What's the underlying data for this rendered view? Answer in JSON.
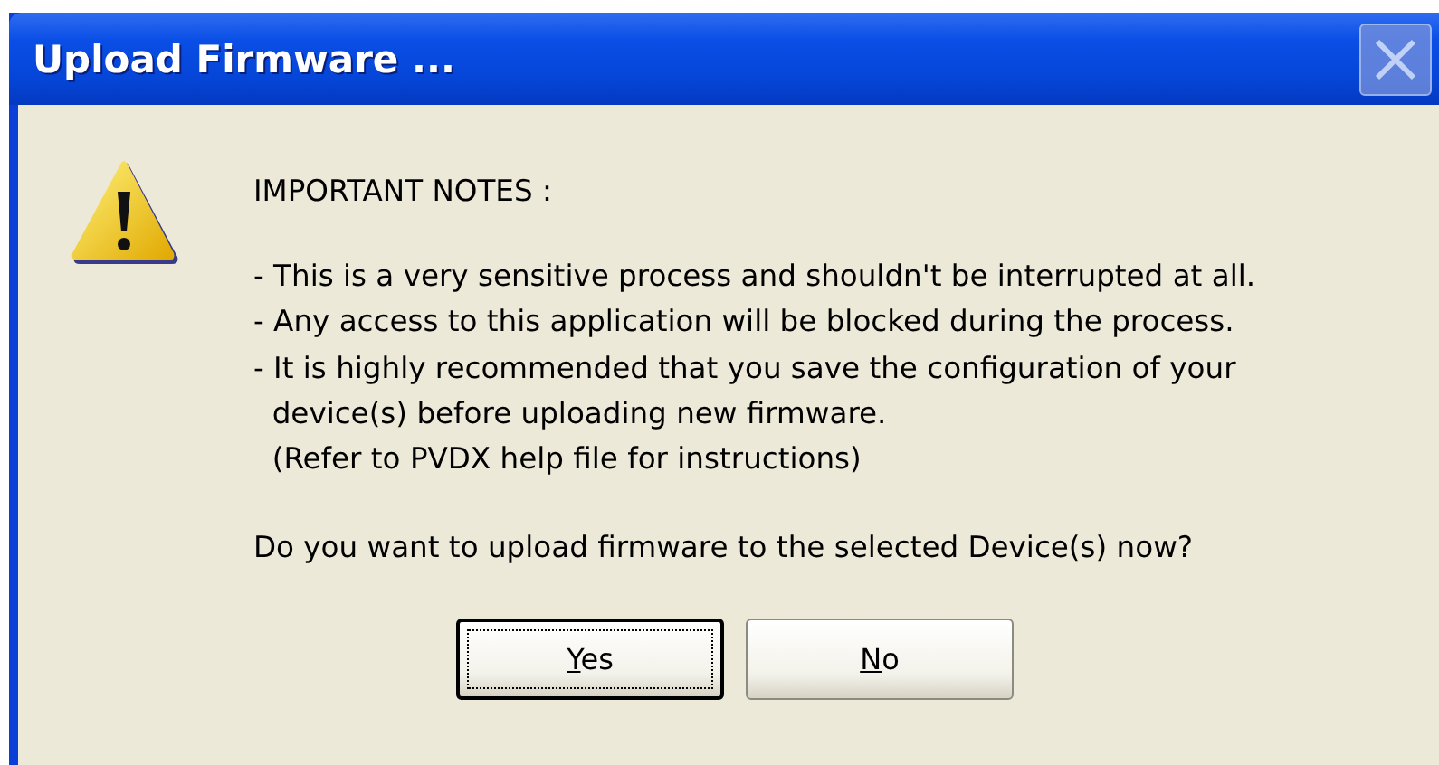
{
  "window": {
    "title": "Upload Firmware ..."
  },
  "message": {
    "heading": "IMPORTANT NOTES :",
    "lines": [
      "- This is a very sensitive process and shouldn't be interrupted at all.",
      "- Any access to this application will be blocked during the process.",
      "- It is highly recommended that you save the configuration of your",
      "  device(s) before uploading new firmware.",
      "  (Refer to PVDX help file for instructions)"
    ],
    "question": "Do you want to upload firmware to the selected Device(s) now?"
  },
  "buttons": [
    {
      "label": "Yes",
      "default": true
    },
    {
      "label": "No",
      "default": false
    }
  ]
}
